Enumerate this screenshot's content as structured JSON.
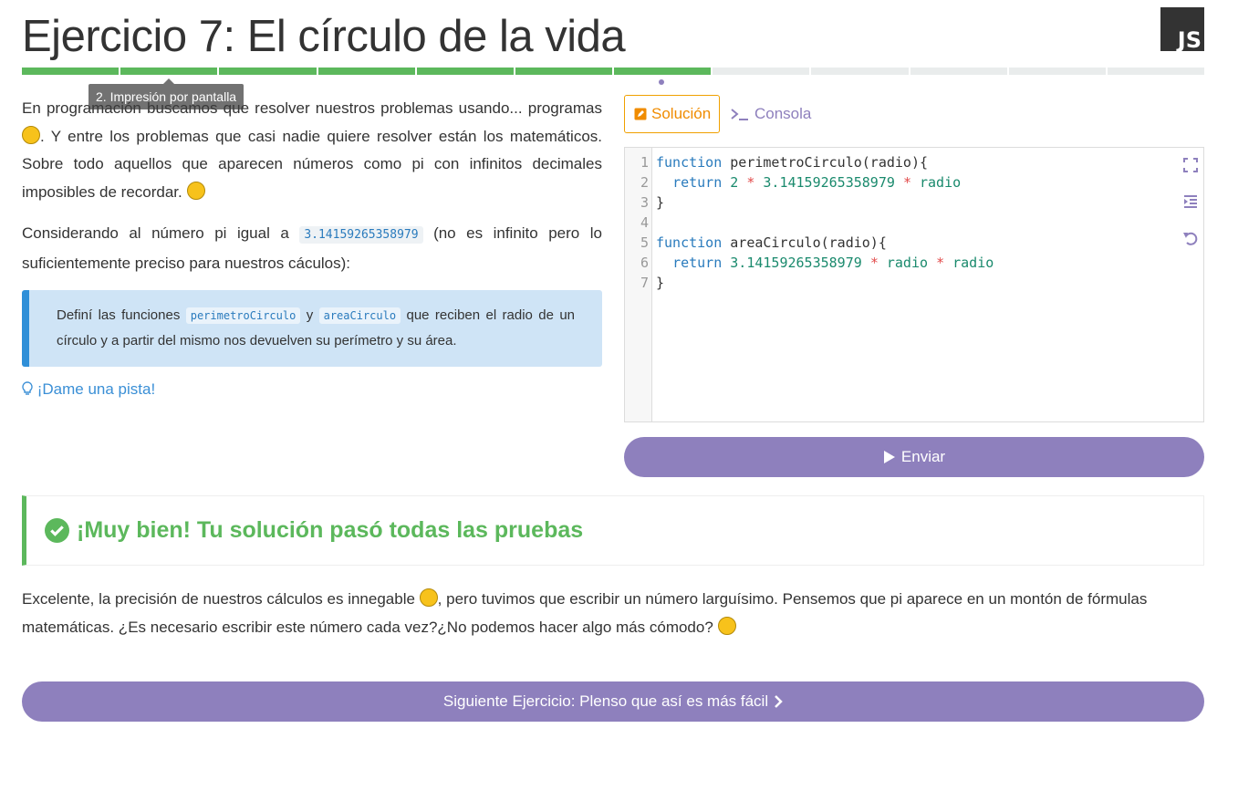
{
  "header": {
    "title": "Ejercicio 7: El círculo de la vida",
    "logo_text": "JS"
  },
  "progress": {
    "total_steps": 12,
    "completed_steps": 7,
    "current_step": 7,
    "tooltip": "2. Impresión por pantalla"
  },
  "description": {
    "p1_a": "En programación buscamos que resolver nuestros problemas usando... programas",
    "p1_b": ". Y entre los problemas que casi nadie quiere resolver están los matemáticos. Sobre todo aquellos que aparecen números como pi con infinitos decimales imposibles de recordar.",
    "p2_a": "Considerando al número pi igual a",
    "p2_code": "3.14159265358979",
    "p2_b": "(no es infinito pero lo suficientemente preciso para nuestros cáculos):"
  },
  "task": {
    "a": "Definí las funciones",
    "code1": "perimetroCirculo",
    "b": "y",
    "code2": "areaCirculo",
    "c": "que reciben el radio de un círculo y a partir del mismo nos devuelven su perímetro y su área."
  },
  "hint": {
    "label": "¡Dame una pista!"
  },
  "tabs": {
    "solution": "Solución",
    "console": "Consola"
  },
  "editor": {
    "line_numbers": [
      "1",
      "2",
      "3",
      "4",
      "5",
      "6",
      "7"
    ],
    "l1_kw": "function",
    "l1_rest": " perimetroCirculo(radio){",
    "l2_kw": "return",
    "l2_num1": "2",
    "l2_op1": "*",
    "l2_num2": "3.14159265358979",
    "l2_op2": "*",
    "l2_var": "radio",
    "l3": "}",
    "l5_kw": "function",
    "l5_rest": " areaCirculo(radio){",
    "l6_kw": "return",
    "l6_num": "3.14159265358979",
    "l6_op1": "*",
    "l6_var1": "radio",
    "l6_op2": "*",
    "l6_var2": "radio",
    "l7": "}"
  },
  "submit": {
    "label": "Enviar"
  },
  "result": {
    "title": "¡Muy bien! Tu solución pasó todas las pruebas"
  },
  "explanation": {
    "a": "Excelente, la precisión de nuestros cálculos es innegable",
    "b": ", pero tuvimos que escribir un número larguísimo. Pensemos que pi aparece en un montón de fórmulas matemáticas. ¿Es necesario escribir este número cada vez?¿No podemos hacer algo más cómodo?"
  },
  "next": {
    "label": "Siguiente Ejercicio: Plenso que así es más fácil"
  },
  "colors": {
    "success": "#5cb85c",
    "accent": "#8e80bd",
    "info_bg": "#cfe4f6",
    "info_border": "#2f8fd8",
    "tab_active": "#f08c00"
  },
  "icons": {
    "logo": "js-logo",
    "hint": "lightbulb-icon",
    "solution_tab": "edit-icon",
    "console_tab": "terminal-icon",
    "fullscreen": "fullscreen-icon",
    "indent": "indent-icon",
    "reset": "undo-icon",
    "submit": "play-icon",
    "result": "check-circle-icon",
    "next": "chevron-right-icon"
  }
}
